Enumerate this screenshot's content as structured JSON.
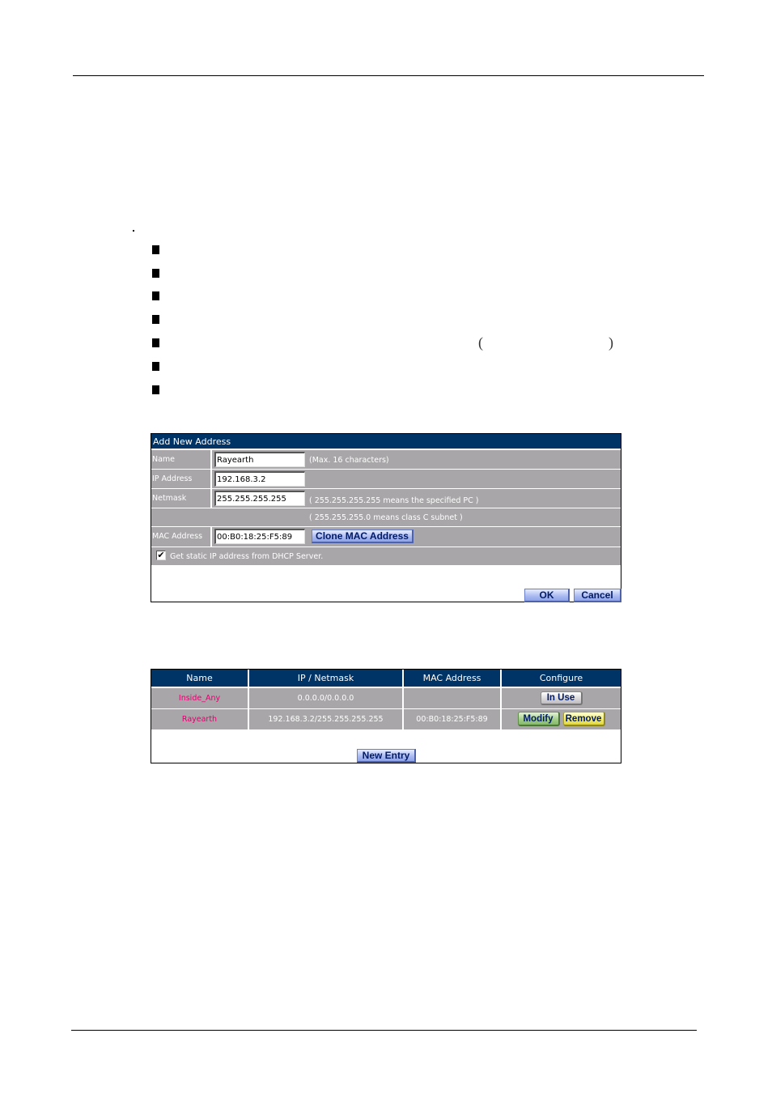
{
  "page": {
    "paren_open": "(",
    "paren_close": ")"
  },
  "add_form": {
    "title": "Add New Address",
    "fields": {
      "name": {
        "label": "Name",
        "value": "Rayearth",
        "hint": "(Max. 16 characters)"
      },
      "ip": {
        "label": "IP Address",
        "value": "192.168.3.2"
      },
      "netmask": {
        "label": "Netmask",
        "value": "255.255.255.255",
        "hint": "( 255.255.255.255 means the specified PC )",
        "hint2": "( 255.255.255.0 means class C subnet )"
      },
      "mac": {
        "label": "MAC Address",
        "value": "00:B0:18:25:F5:89"
      }
    },
    "clone_button": "Clone MAC Address",
    "dhcp_checkbox": {
      "label": "Get static IP address from DHCP Server.",
      "checked": true,
      "mark": "✔"
    },
    "ok_button": "OK",
    "cancel_button": "Cancel"
  },
  "address_table": {
    "headers": [
      "Name",
      "IP / Netmask",
      "MAC Address",
      "Configure"
    ],
    "rows": [
      {
        "name": "Inside_Any",
        "ip_netmask": "0.0.0.0/0.0.0.0",
        "mac": "",
        "in_use_label": "In  Use"
      },
      {
        "name": "Rayearth",
        "ip_netmask": "192.168.3.2/255.255.255.255",
        "mac": "00:B0:18:25:F5:89",
        "modify_label": "Modify",
        "remove_label": "Remove"
      }
    ],
    "new_entry_button": "New Entry"
  },
  "colors": {
    "header_bg": "#003366",
    "row_bg": "#a8a6a8",
    "name_text": "#e0006e"
  }
}
